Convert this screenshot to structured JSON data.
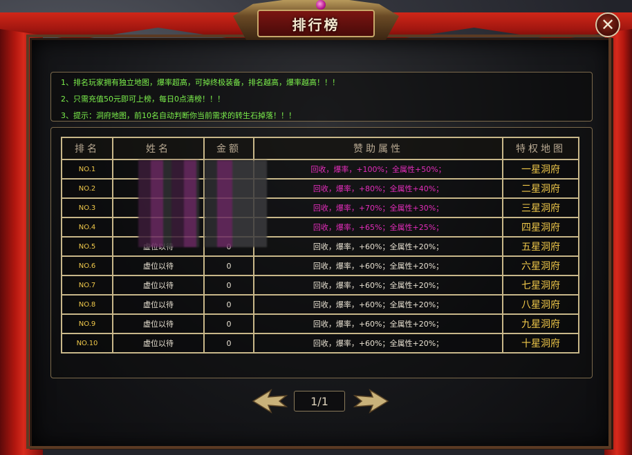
{
  "window": {
    "title": "排行榜",
    "close_label": "✕"
  },
  "notice": {
    "lines": [
      "1、排名玩家拥有独立地图，爆率超高，可掉终极装备，排名越高，爆率越高！！！",
      "2、只需充值50元即可上榜，每日0点清榜！！！",
      "3、提示：洞府地图，前10名自动判断你当前需求的转生石掉落！！！"
    ]
  },
  "table": {
    "headers": [
      "排名",
      "姓名",
      "金额",
      "赞助属性",
      "特权地图"
    ],
    "rows": [
      {
        "rank": "NO.1",
        "name": "",
        "amount": "",
        "attr": "回收，爆率，+100%；全属性+50%；",
        "map": "一星洞府"
      },
      {
        "rank": "NO.2",
        "name": "",
        "amount": "",
        "attr": "回收，爆率，+80%；全属性+40%；",
        "map": "二星洞府"
      },
      {
        "rank": "NO.3",
        "name": "",
        "amount": "",
        "attr": "回收，爆率，+70%；全属性+30%；",
        "map": "三星洞府"
      },
      {
        "rank": "NO.4",
        "name": "",
        "amount": "",
        "attr": "回收，爆率，+65%；全属性+25%；",
        "map": "四星洞府"
      },
      {
        "rank": "NO.5",
        "name": "虚位以待",
        "amount": "0",
        "attr": "回收，爆率，+60%；全属性+20%；",
        "map": "五星洞府"
      },
      {
        "rank": "NO.6",
        "name": "虚位以待",
        "amount": "0",
        "attr": "回收，爆率，+60%；全属性+20%；",
        "map": "六星洞府"
      },
      {
        "rank": "NO.7",
        "name": "虚位以待",
        "amount": "0",
        "attr": "回收，爆率，+60%；全属性+20%；",
        "map": "七星洞府"
      },
      {
        "rank": "NO.8",
        "name": "虚位以待",
        "amount": "0",
        "attr": "回收，爆率，+60%；全属性+20%；",
        "map": "八星洞府"
      },
      {
        "rank": "NO.9",
        "name": "虚位以待",
        "amount": "0",
        "attr": "回收，爆率，+60%；全属性+20%；",
        "map": "九星洞府"
      },
      {
        "rank": "NO.10",
        "name": "虚位以待",
        "amount": "0",
        "attr": "回收，爆率，+60%；全属性+20%；",
        "map": "十星洞府"
      }
    ]
  },
  "pager": {
    "label": "1/1",
    "prev_icon": "left-arrow-icon",
    "next_icon": "right-arrow-icon"
  },
  "colors": {
    "notice_text": "#7cf04c",
    "rank_text": "#f1c94a",
    "top_attr_text": "#e42dbb",
    "normal_text": "#e9e2d3",
    "border_gold": "#c9b88a"
  }
}
